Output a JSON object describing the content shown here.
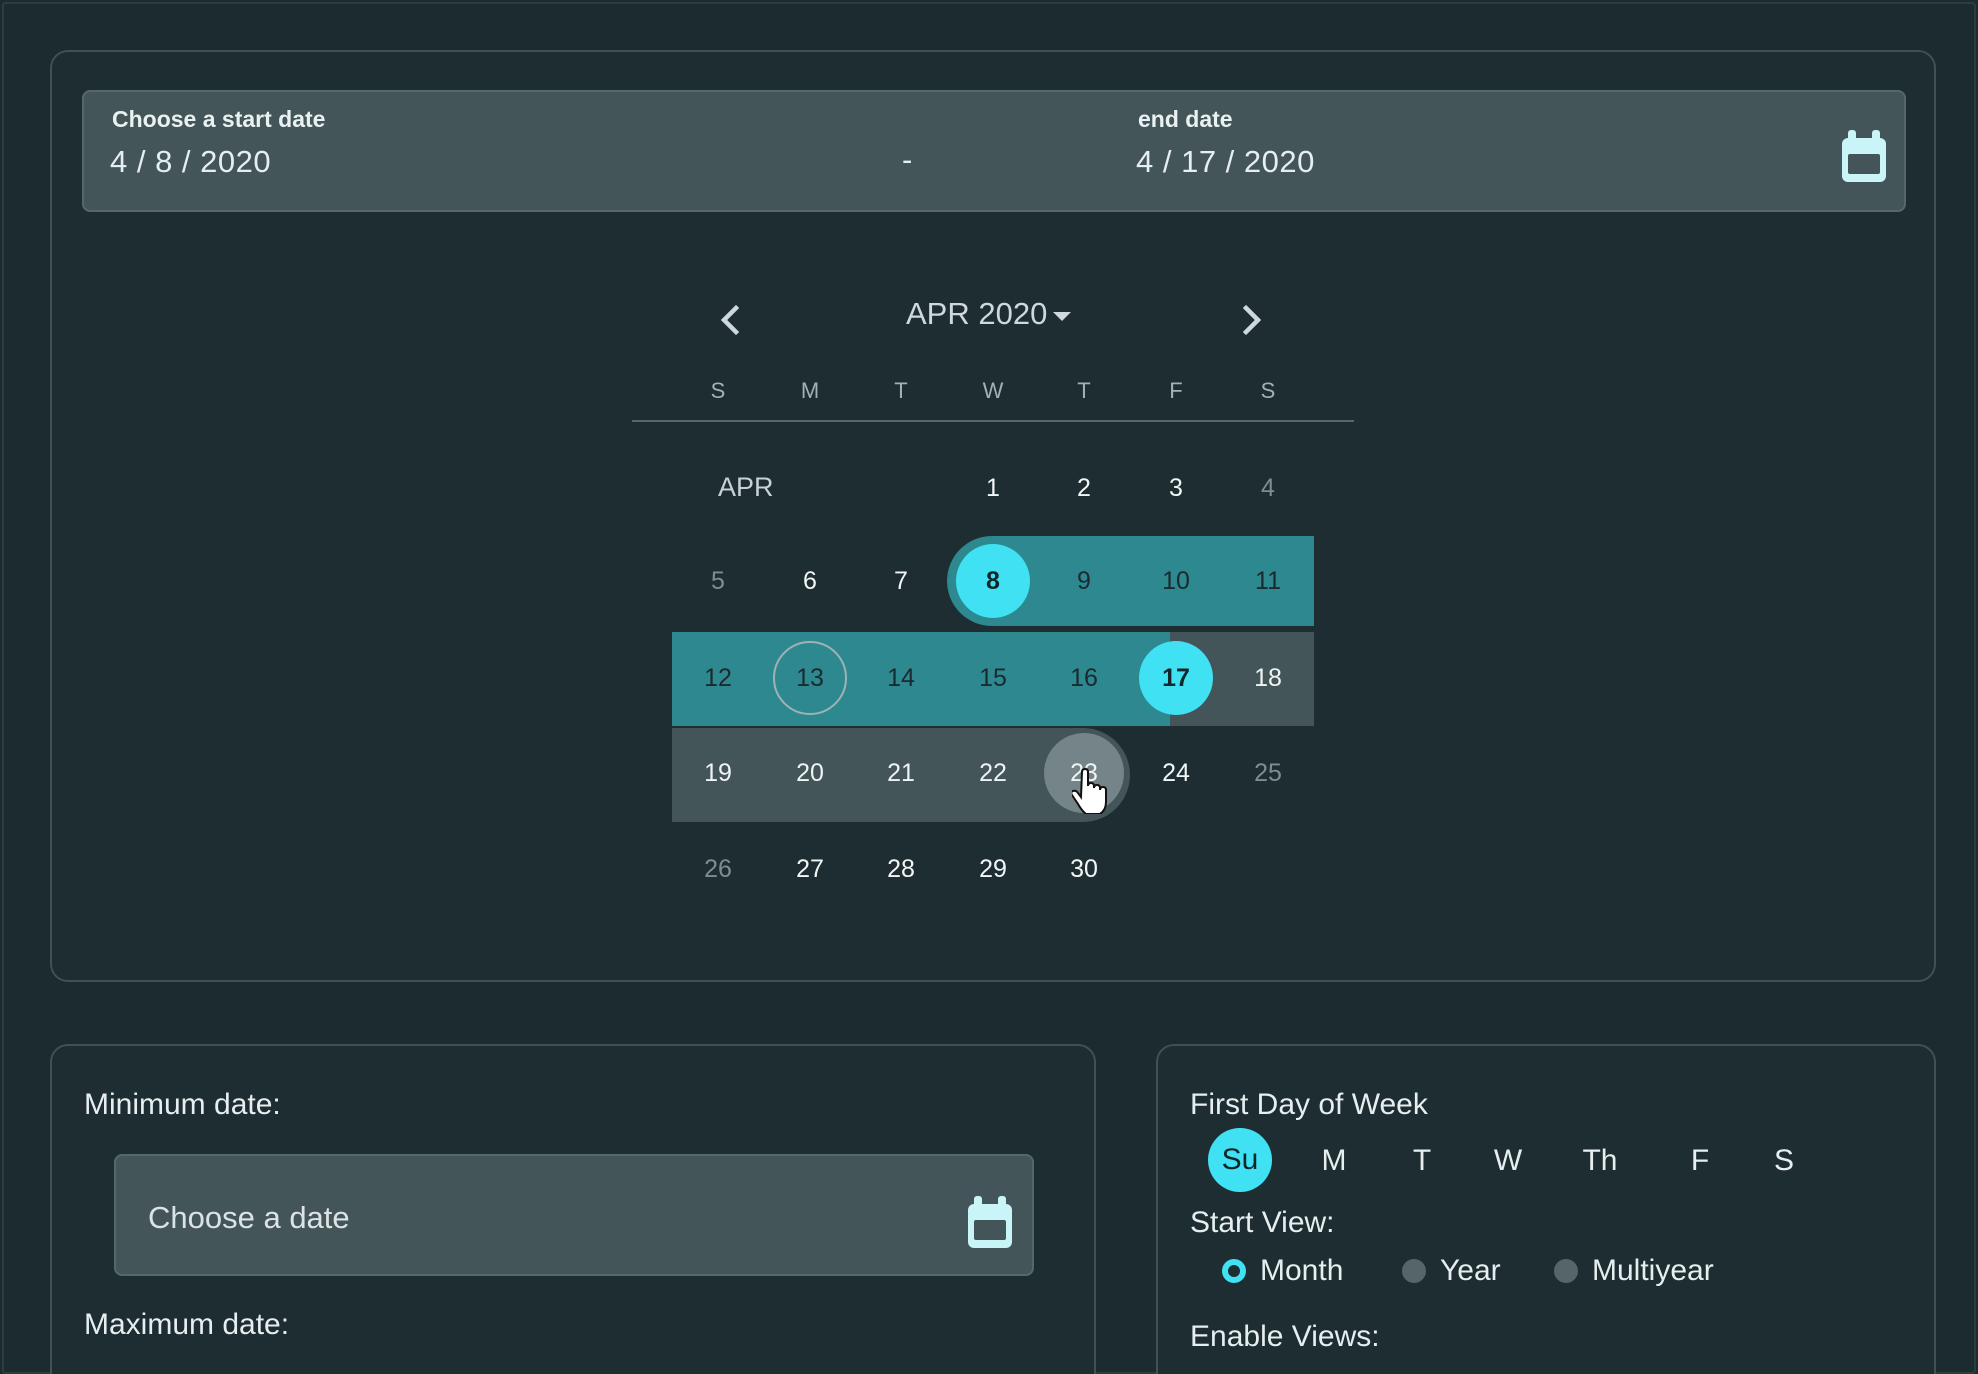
{
  "range": {
    "start_label": "Choose a start date",
    "start_value": "4 / 8 / 2020",
    "separator": "-",
    "end_label": "end date",
    "end_value": "4 / 17 / 2020",
    "icon": "calendar-icon"
  },
  "calendar": {
    "period": "APR 2020",
    "month_label": "APR",
    "weekdays": [
      "S",
      "M",
      "T",
      "W",
      "T",
      "F",
      "S"
    ],
    "days": [
      "1",
      "2",
      "3",
      "4",
      "5",
      "6",
      "7",
      "8",
      "9",
      "10",
      "11",
      "12",
      "13",
      "14",
      "15",
      "16",
      "17",
      "18",
      "19",
      "20",
      "21",
      "22",
      "23",
      "24",
      "25",
      "26",
      "27",
      "28",
      "29",
      "30"
    ],
    "selected_start": "8",
    "selected_end": "17",
    "today": "13",
    "hovered": "23"
  },
  "minmax": {
    "min_label": "Minimum date:",
    "min_placeholder": "Choose a date",
    "max_label": "Maximum date:"
  },
  "settings": {
    "first_day_label": "First Day of Week",
    "first_day_options": [
      "Su",
      "M",
      "T",
      "W",
      "Th",
      "F",
      "S"
    ],
    "first_day_selected": "Su",
    "start_view_label": "Start View:",
    "start_view_options": [
      "Month",
      "Year",
      "Multiyear"
    ],
    "start_view_selected": "Month",
    "enable_views_label": "Enable Views:"
  },
  "colors": {
    "accent": "#3fe1f3",
    "range": "#2e8890",
    "preview": "#435559",
    "background": "#1b2b2f"
  }
}
